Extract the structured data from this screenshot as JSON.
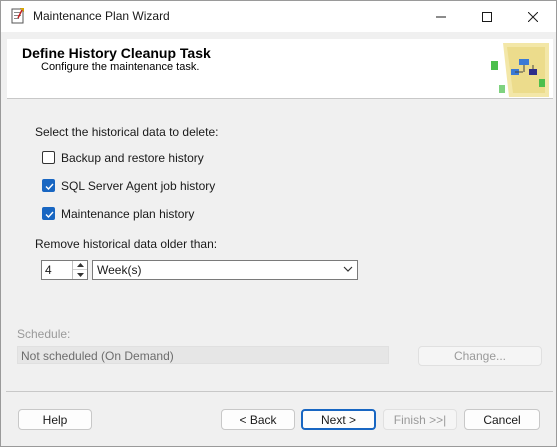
{
  "window": {
    "title": "Maintenance Plan Wizard",
    "controls": {
      "minimize": "minimize",
      "maximize": "maximize",
      "close": "close"
    }
  },
  "header": {
    "title": "Define History Cleanup Task",
    "subtitle": "Configure the maintenance task."
  },
  "body": {
    "select_label": "Select the historical data to delete:",
    "options": [
      {
        "label": "Backup and restore history",
        "checked": false
      },
      {
        "label": "SQL Server Agent job history",
        "checked": true
      },
      {
        "label": "Maintenance plan history",
        "checked": true
      }
    ],
    "age_label": "Remove historical data older than:",
    "age_value": "4",
    "age_unit": "Week(s)"
  },
  "schedule": {
    "label": "Schedule:",
    "value": "Not scheduled (On Demand)",
    "change_button": "Change..."
  },
  "footer": {
    "help": "Help",
    "back": "< Back",
    "next": "Next >",
    "finish": "Finish >>|",
    "cancel": "Cancel"
  },
  "colors": {
    "accent": "#1866c2",
    "disabled_text": "#9a9a9a"
  }
}
